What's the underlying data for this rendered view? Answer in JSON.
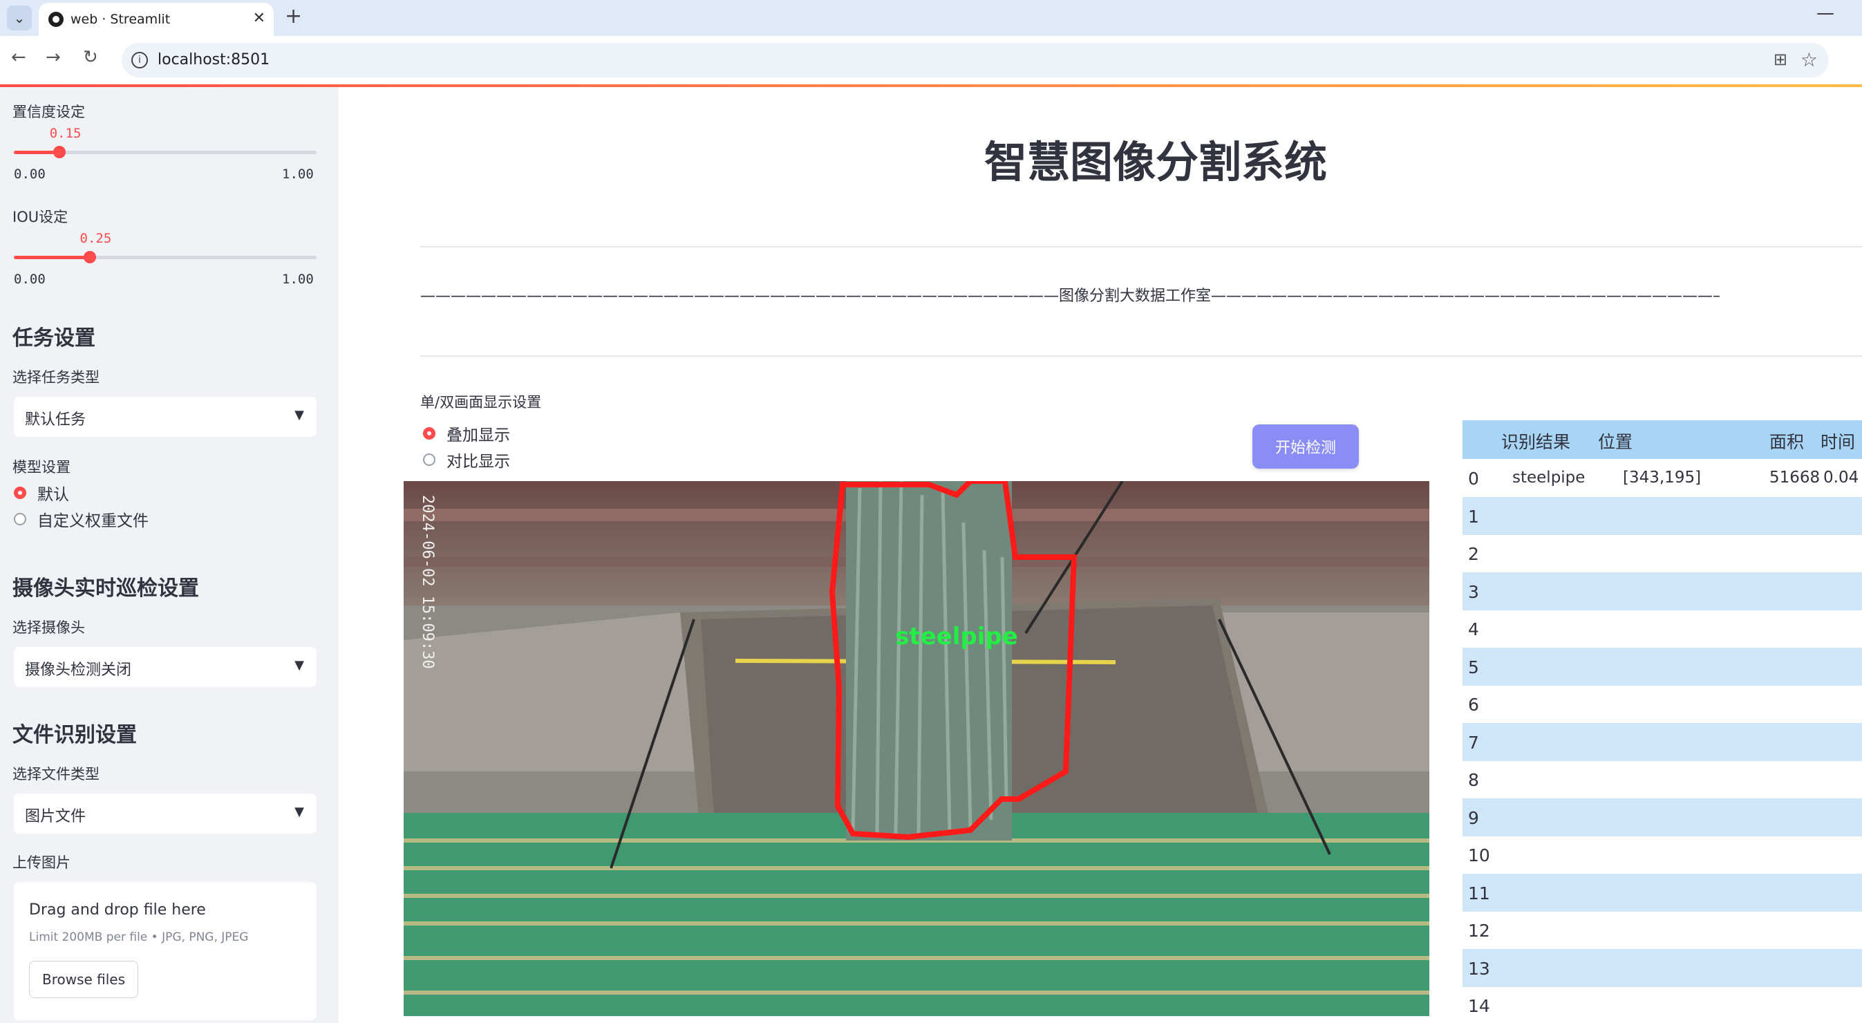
{
  "browser": {
    "tab_title": "web · Streamlit",
    "url": "localhost:8501",
    "tab_close": "✕",
    "new_tab": "+",
    "minimize": "—"
  },
  "sidebar": {
    "confidence": {
      "label": "置信度设定",
      "value": "0.15",
      "fraction": 0.15,
      "min": "0.00",
      "max": "1.00"
    },
    "iou": {
      "label": "IOU设定",
      "value": "0.25",
      "fraction": 0.25,
      "min": "0.00",
      "max": "1.00"
    },
    "task_heading": "任务设置",
    "task_type_label": "选择任务类型",
    "task_type_value": "默认任务",
    "model_label": "模型设置",
    "model_options": [
      "默认",
      "自定义权重文件"
    ],
    "model_selected": "默认",
    "camera_heading": "摄像头实时巡检设置",
    "camera_label": "选择摄像头",
    "camera_value": "摄像头检测关闭",
    "file_heading": "文件识别设置",
    "file_type_label": "选择文件类型",
    "file_type_value": "图片文件",
    "upload_label": "上传图片",
    "upload_title": "Drag and drop file here",
    "upload_limit": "Limit 200MB per file • JPG, PNG, JPEG",
    "browse_label": "Browse files"
  },
  "main": {
    "title": "智慧图像分割系统",
    "divider_text": "——————————————————————————————————————————图像分割大数据工作室——————————————————————————————————————————",
    "display_label": "单/双画面显示设置",
    "display_options": [
      "叠加显示",
      "对比显示"
    ],
    "display_selected": "叠加显示",
    "start_button": "开始检测",
    "image": {
      "timestamp": "2024-06-02 15:09:30",
      "detection_label": "steelpipe",
      "mask_color": "#ff1a1a",
      "label_color": "#22ee44"
    }
  },
  "table": {
    "headers": [
      "识别结果",
      "位置",
      "面积",
      "时间"
    ],
    "rows": [
      {
        "idx": "0",
        "result": "steelpipe",
        "position": "[343,195]",
        "area": "51668",
        "time": "0.04"
      },
      {
        "idx": "1"
      },
      {
        "idx": "2"
      },
      {
        "idx": "3"
      },
      {
        "idx": "4"
      },
      {
        "idx": "5"
      },
      {
        "idx": "6"
      },
      {
        "idx": "7"
      },
      {
        "idx": "8"
      },
      {
        "idx": "9"
      },
      {
        "idx": "10"
      },
      {
        "idx": "11"
      },
      {
        "idx": "12"
      },
      {
        "idx": "13"
      },
      {
        "idx": "14"
      }
    ]
  },
  "colors": {
    "accent": "#ff4b4b",
    "button": "#8b8df6",
    "table_header": "#a8d4f5",
    "table_alt": "#cfe6f9",
    "sidebar_bg": "#f0f2f6"
  }
}
